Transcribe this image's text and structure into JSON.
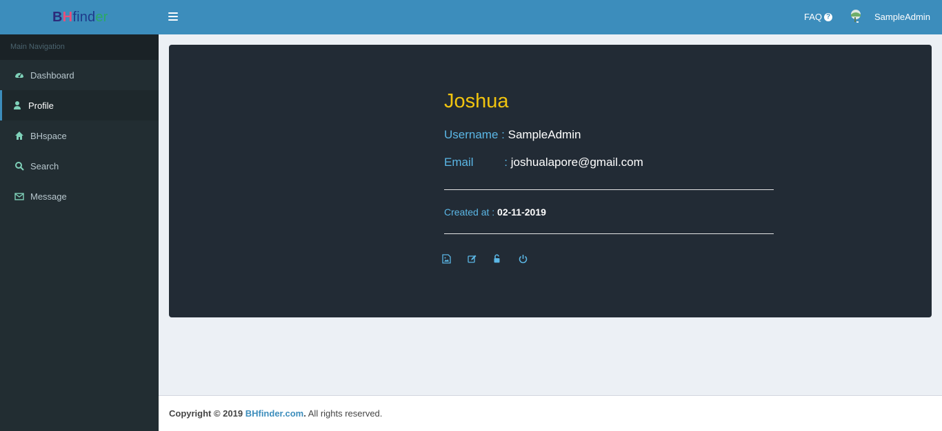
{
  "header": {
    "logo": {
      "part1": "B",
      "part2": "H",
      "part3": "find",
      "part4": "er"
    },
    "faq_label": "FAQ",
    "user_name": "SampleAdmin"
  },
  "sidebar": {
    "header": "Main Navigation",
    "items": [
      {
        "label": "Dashboard",
        "icon": "dashboard-icon"
      },
      {
        "label": "Profile",
        "icon": "user-icon",
        "active": true
      },
      {
        "label": "BHspace",
        "icon": "home-icon"
      },
      {
        "label": "Search",
        "icon": "search-icon"
      },
      {
        "label": "Message",
        "icon": "envelope-icon"
      }
    ]
  },
  "profile": {
    "name": "Joshua",
    "username_label": "Username :",
    "username_value": "SampleAdmin",
    "email_label": "Email",
    "email_sep": ":",
    "email_value": "joshualapore@gmail.com",
    "created_label": "Created at :",
    "created_value": "02-11-2019",
    "actions": [
      "image-icon",
      "edit-icon",
      "unlock-icon",
      "power-icon"
    ]
  },
  "footer": {
    "prefix": "Copyright © 2019 ",
    "link": "BHfinder.com",
    "suffix_bold": ".",
    "suffix": " All rights reserved."
  },
  "colors": {
    "header_bg": "#3c8dbc",
    "sidebar_bg": "#222d32",
    "card_bg": "#222b35",
    "name_color": "#f1c40f",
    "label_color": "#5bb7e6"
  }
}
